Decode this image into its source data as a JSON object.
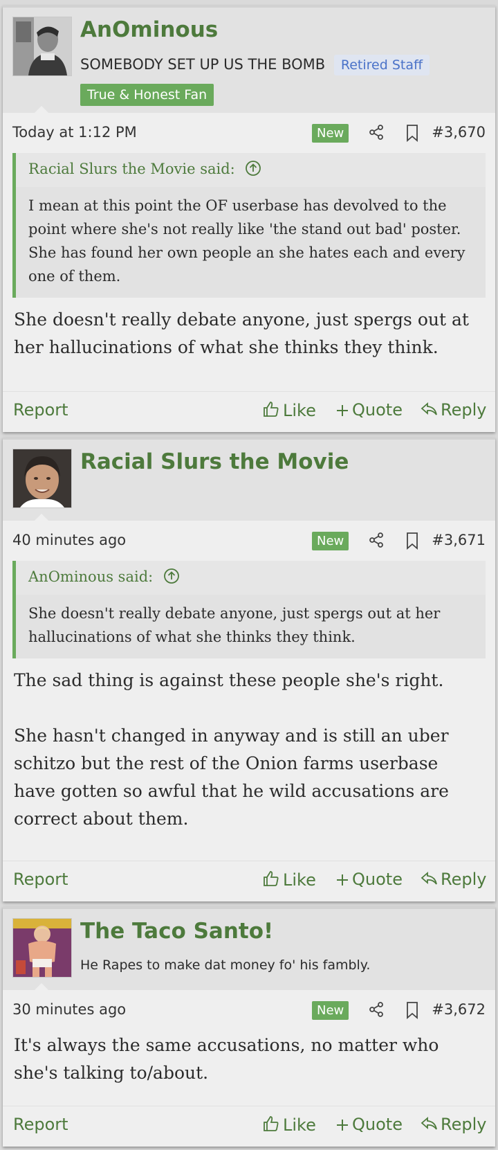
{
  "colors": {
    "accent": "#4d7a3c",
    "badge": "#6aaa5c",
    "staff_bg": "#dfe5f1",
    "staff_text": "#4a72c8"
  },
  "posts": [
    {
      "username": "AnOminous",
      "user_title": "SOMEBODY SET UP US THE BOMB",
      "staff_banner": "Retired Staff",
      "fan_banner": "True & Honest Fan",
      "time": "Today at 1:12 PM",
      "badge": "New",
      "post_number": "#3,670",
      "quote": {
        "author_said": "Racial Slurs the Movie said:",
        "text": "I mean at this point the OF userbase has devolved to the point where she's not really like 'the stand out bad' poster. She has found her own people an she hates each and every one of them."
      },
      "message": [
        "She doesn't really debate anyone, just spergs out at her hallucinations of what she thinks they think."
      ],
      "actions": {
        "report": "Report",
        "like": "Like",
        "quote": "Quote",
        "reply": "Reply"
      }
    },
    {
      "username": "Racial Slurs the Movie",
      "time": "40 minutes ago",
      "badge": "New",
      "post_number": "#3,671",
      "quote": {
        "author_said": "AnOminous said:",
        "text": "She doesn't really debate anyone, just spergs out at her hallucinations of what she thinks they think."
      },
      "message": [
        "The sad thing is against these people she's right.",
        "She hasn't changed in anyway and is still an uber schitzo but the rest of the Onion farms userbase have gotten so awful that he wild accusations are correct about them."
      ],
      "actions": {
        "report": "Report",
        "like": "Like",
        "quote": "Quote",
        "reply": "Reply"
      }
    },
    {
      "username": "The Taco Santo!",
      "user_title": "He Rapes to make dat money fo' his fambly.",
      "time": "30 minutes ago",
      "badge": "New",
      "post_number": "#3,672",
      "message": [
        "It's always the same accusations, no matter who she's talking to/about."
      ],
      "actions": {
        "report": "Report",
        "like": "Like",
        "quote": "Quote",
        "reply": "Reply"
      }
    }
  ]
}
